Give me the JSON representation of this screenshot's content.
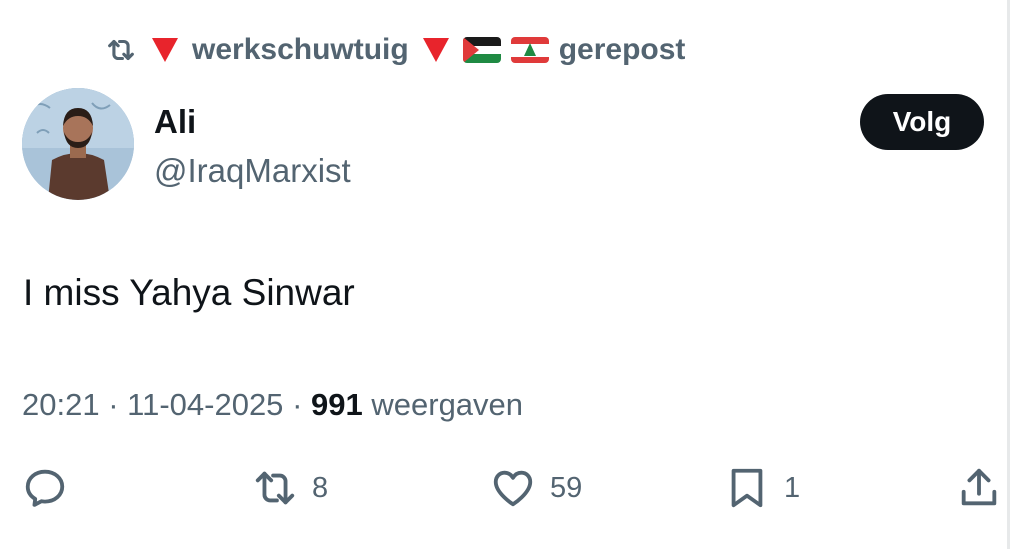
{
  "repost": {
    "icon": "repost-icon",
    "user": "werkschuwtuig",
    "emoji": [
      "red-triangle-down",
      "red-triangle-down",
      "flag-palestine",
      "flag-lebanon"
    ],
    "action": "gerepost"
  },
  "author": {
    "name": "Ali",
    "handle": "@IraqMarxist",
    "avatar_icon": "avatar"
  },
  "follow_label": "Volg",
  "tweet": {
    "text": "I miss Yahya Sinwar"
  },
  "meta": {
    "time": "20:21",
    "sep1": "·",
    "date": "11-04-2025",
    "sep2": "·",
    "views": "991",
    "views_label": "weergaven"
  },
  "actions": {
    "reply": {
      "icon": "reply-icon",
      "count": ""
    },
    "repost": {
      "icon": "repost-icon",
      "count": "8"
    },
    "like": {
      "icon": "heart-icon",
      "count": "59"
    },
    "bookmark": {
      "icon": "bookmark-icon",
      "count": "1"
    },
    "share": {
      "icon": "share-icon",
      "count": ""
    }
  },
  "colors": {
    "text": "#0f1419",
    "secondary": "#536471",
    "button_bg": "#0f1419",
    "triangle": "#e8242c"
  }
}
